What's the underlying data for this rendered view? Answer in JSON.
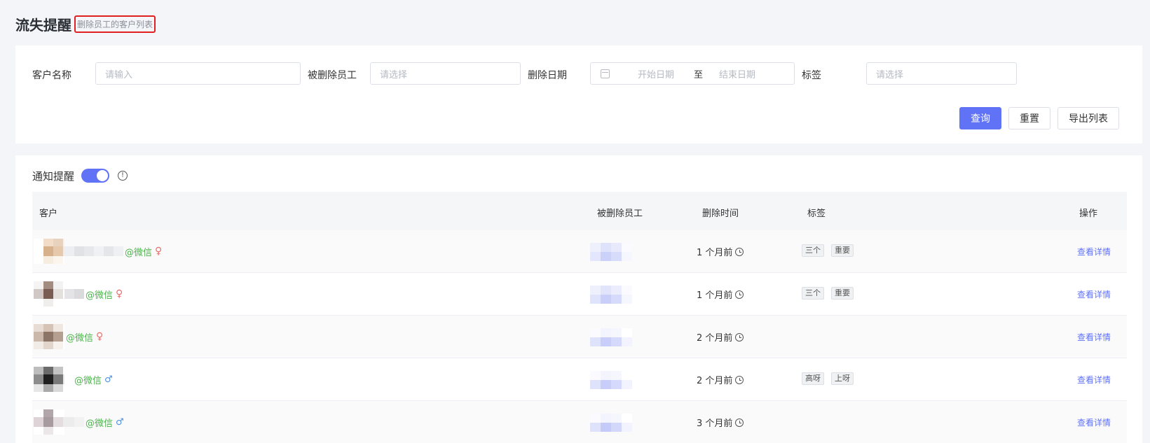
{
  "page": {
    "title": "流失提醒",
    "subtitle": "删除员工的客户列表"
  },
  "filters": {
    "customer_name": {
      "label": "客户名称",
      "placeholder": "请输入"
    },
    "deleted_employee": {
      "label": "被删除员工",
      "placeholder": "请选择"
    },
    "delete_date": {
      "label": "删除日期",
      "start_placeholder": "开始日期",
      "separator": "至",
      "end_placeholder": "结束日期"
    },
    "tag": {
      "label": "标签",
      "placeholder": "请选择"
    }
  },
  "buttons": {
    "query": "查询",
    "reset": "重置",
    "export": "导出列表"
  },
  "notify": {
    "label": "通知提醒",
    "enabled": true,
    "info_icon": "info-circle-icon",
    "info_glyph": "!"
  },
  "table": {
    "columns": [
      "客户",
      "被删除员工",
      "删除时间",
      "标签",
      "操作"
    ],
    "rows": [
      {
        "suffix": "@微信",
        "gender": "♀",
        "time": "1 个月前",
        "tags": [
          "三个",
          "重要"
        ],
        "action": "查看详情"
      },
      {
        "suffix": "@微信",
        "gender": "♀",
        "time": "1 个月前",
        "tags": [
          "三个",
          "重要"
        ],
        "action": "查看详情"
      },
      {
        "suffix": "@微信",
        "gender": "♀",
        "time": "2 个月前",
        "tags": [],
        "action": "查看详情"
      },
      {
        "suffix": "@微信",
        "gender": "♂",
        "time": "2 个月前",
        "tags": [
          "高呀",
          "上呀"
        ],
        "action": "查看详情"
      },
      {
        "suffix": "@微信",
        "gender": "♂",
        "time": "3 个月前",
        "tags": [],
        "action": "查看详情"
      }
    ]
  },
  "colors": {
    "primary": "#6072f6",
    "wechat_green": "#4db34d",
    "female": "#e96e6e",
    "male": "#4a90e2",
    "highlight_border": "#e02020"
  }
}
